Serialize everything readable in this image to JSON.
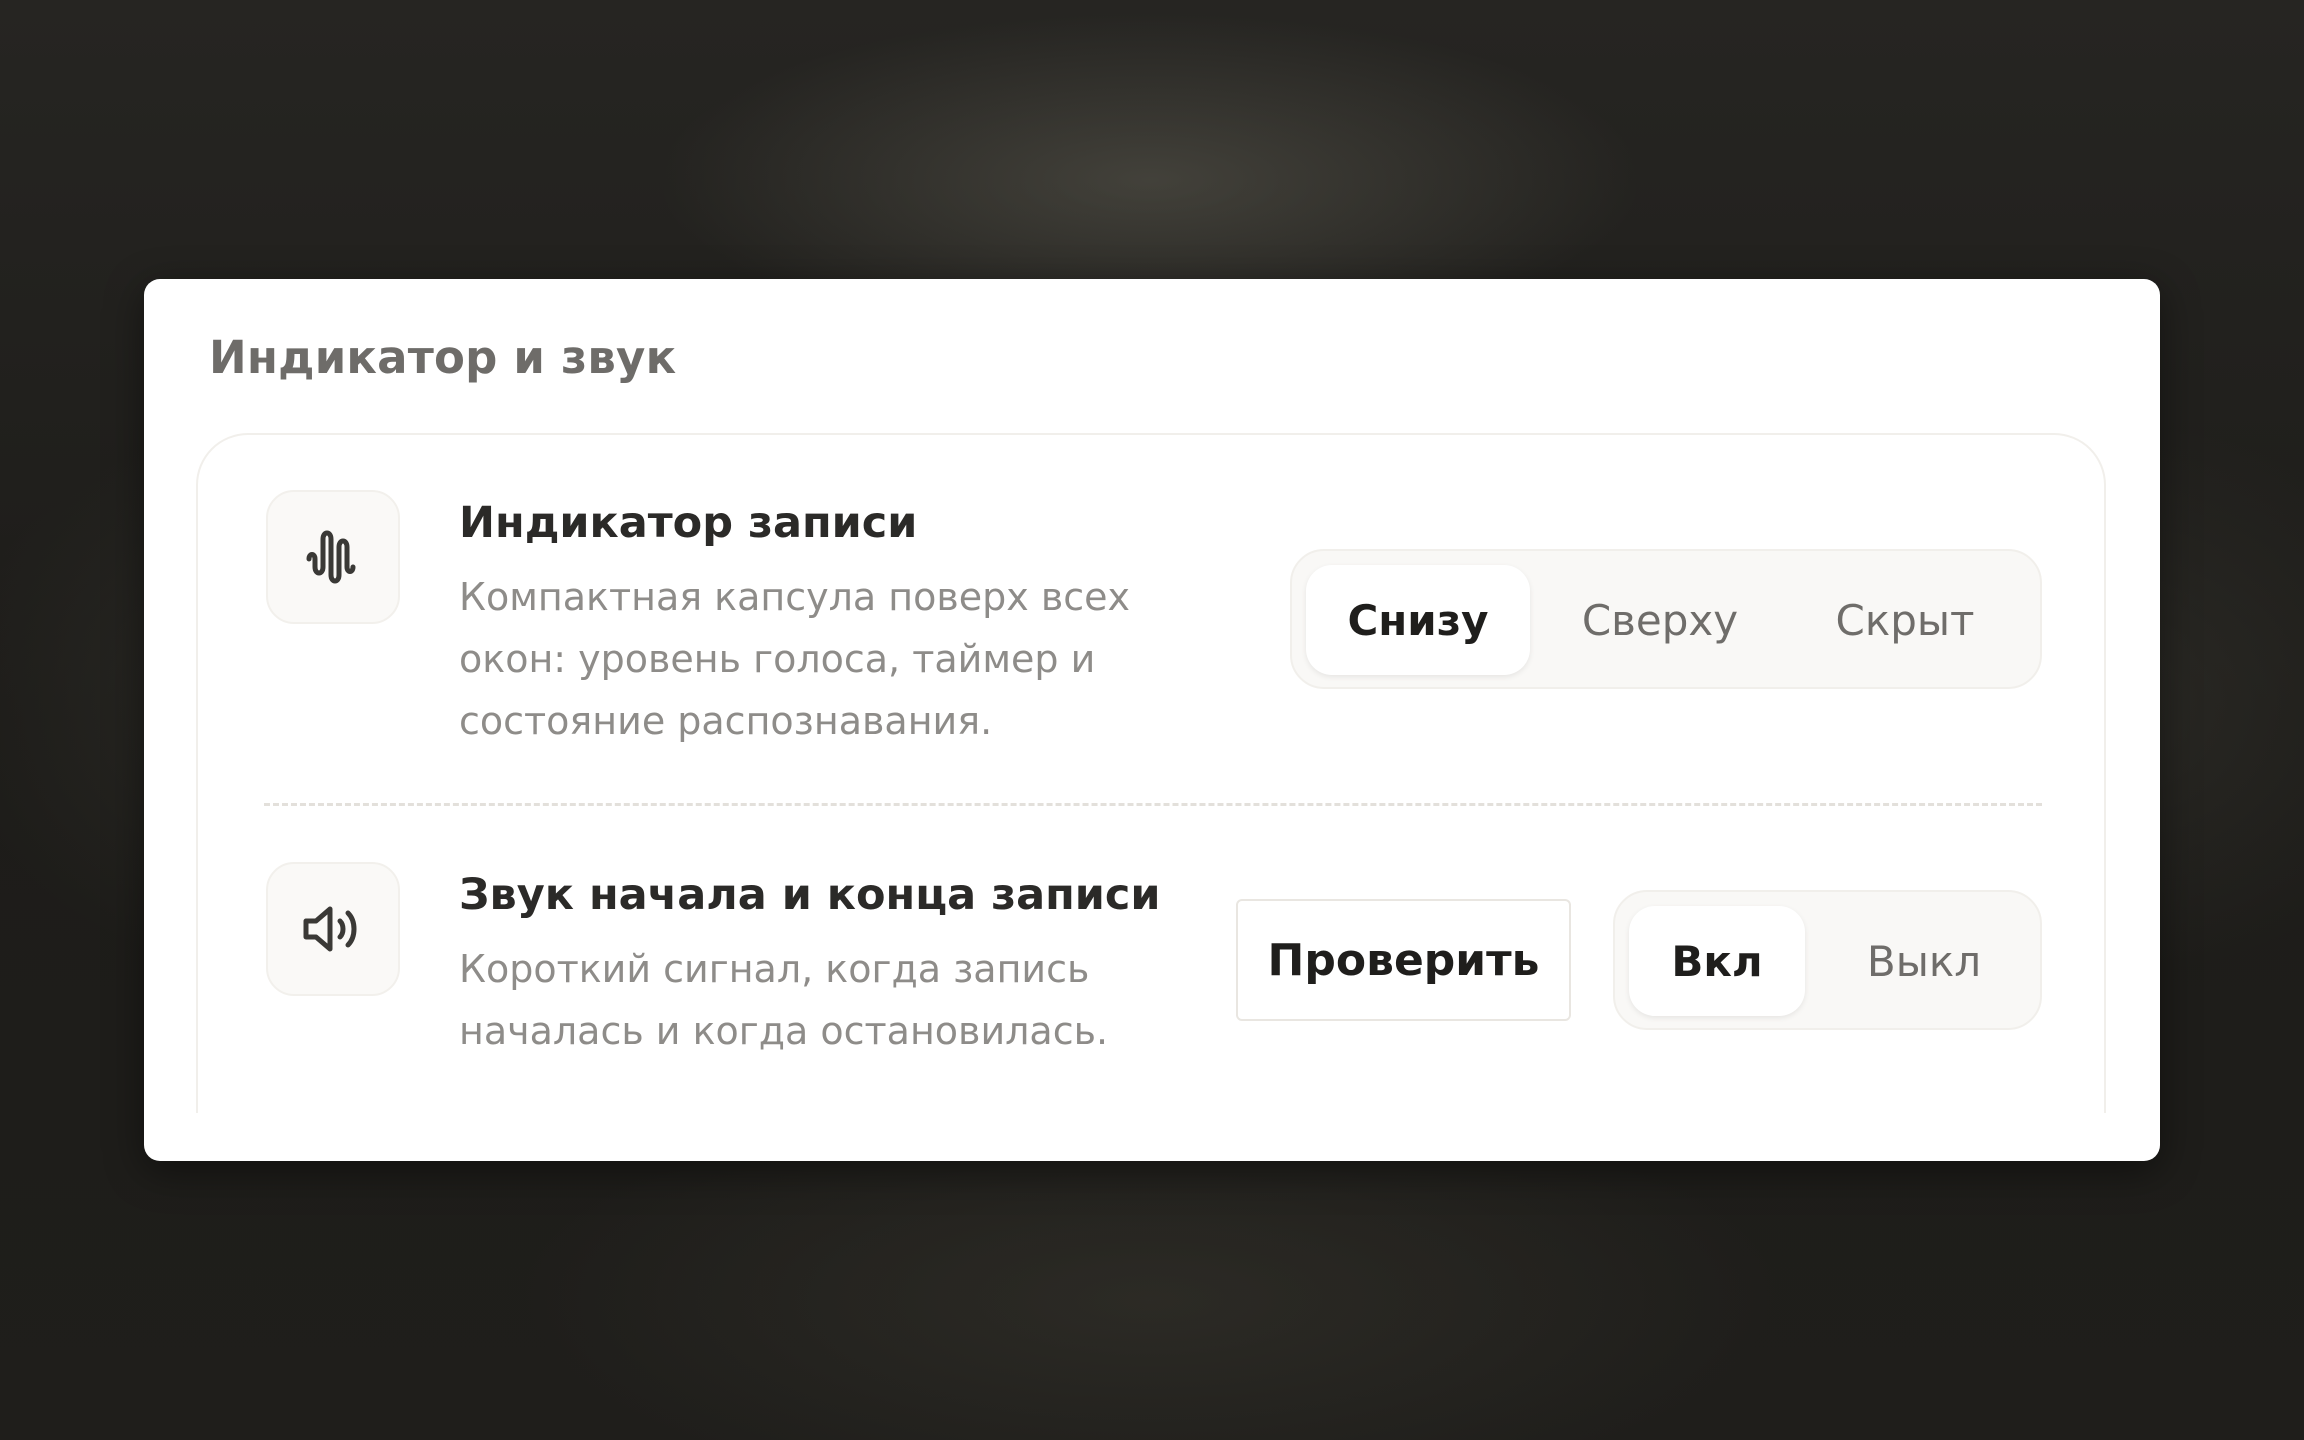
{
  "section": {
    "title": "Индикатор и звук"
  },
  "rows": [
    {
      "icon": "waveform-icon",
      "title": "Индикатор записи",
      "description_lines": [
        "Компактная капсула поверх всех",
        "окон: уровень голоса, таймер и",
        "состояние распознавания."
      ],
      "segmented": {
        "options": [
          "Снизу",
          "Сверху",
          "Скрыт"
        ],
        "selected": "Снизу"
      }
    },
    {
      "icon": "speaker-icon",
      "title": "Звук начала и конца записи",
      "description_lines": [
        "Короткий сигнал, когда запись",
        "началась и когда остановилась."
      ],
      "test_button": "Проверить",
      "segmented": {
        "options": [
          "Вкл",
          "Выкл"
        ],
        "selected": "Вкл"
      }
    }
  ],
  "colors": {
    "panel_background": "#ffffff",
    "title_text": "#2b2a28",
    "secondary_text": "#8e8c89",
    "segment_background": "#f9f8f6",
    "backdrop": "#1f1e1b"
  }
}
